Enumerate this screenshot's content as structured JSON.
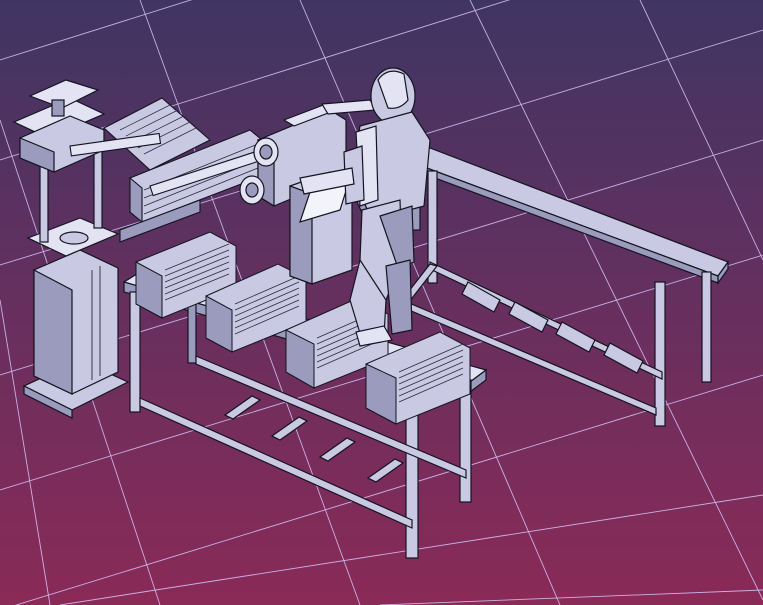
{
  "viewport": {
    "background": {
      "top": "#3f3563",
      "middle": "#6a2f5e",
      "bottom": "#8a2a57"
    },
    "grid_color": "#d9c7ff"
  },
  "model": {
    "part_fill": "#c9c9e4",
    "part_fill_light": "#e3e3f3",
    "part_fill_dark": "#9b9bbd",
    "edge_color": "#141420",
    "components": [
      "worker-mannequin",
      "feeder-machine",
      "roller-assembly",
      "lift-column",
      "conveyor-tray-bench",
      "component-tray",
      "side-workbench"
    ]
  }
}
